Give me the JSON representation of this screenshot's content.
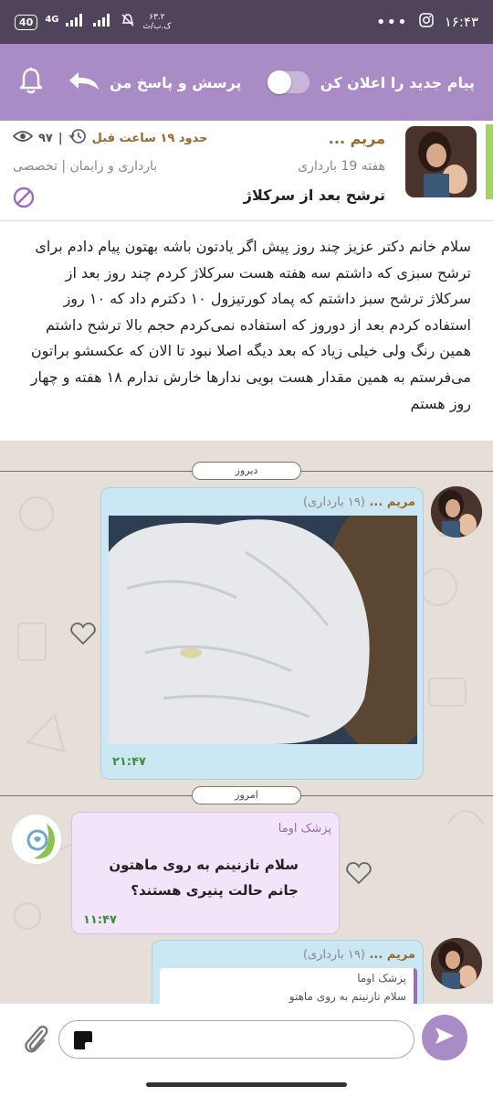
{
  "status_bar": {
    "time": "۱۶:۴۳",
    "battery": "40",
    "network": "4G",
    "data_speed_value": "۶۳.۲",
    "data_speed_unit": "ک.ب/ث",
    "icons": [
      "battery-icon",
      "signal-icon",
      "mute-icon",
      "instagram-icon",
      "more-icon"
    ]
  },
  "top_bar": {
    "notify_label": "پیام جدید را اعلان کن",
    "qa_label": "پرسش و پاسخ من",
    "notify_toggle_on": false,
    "colors": {
      "background": "#a98cc5"
    }
  },
  "post": {
    "author": "مریم ...",
    "week": "هفته 19 بارداری",
    "time_ago": "حدود ۱۹ ساعت قبل",
    "views": "۹۷",
    "category": "بارداری و زایمان | تخصصی",
    "title": "ترشح بعد از سرکلاژ",
    "body": "سلام خانم دکتر عزیز چند روز پیش اگر یادتون باشه بهتون پیام دادم برای ترشح سبزی که داشتم سه هفته هست سرکلاژ کردم چند روز بعد از سرکلاژ ترشح سبز داشتم که پماد کورتیزول ۱۰ دکترم داد که ۱۰ روز استفاده کردم بعد از دوروز که استفاده نمی‌کردم  حجم بالا ترشح داشتم همین رنگ ولی خیلی زیاد که بعد دیگه اصلا نبود تا الان که عکسشو براتون می‌فرستم به همین مقدار هست بویی ندارها خارش ندارم ۱۸ هفته و چهار روز هستم"
  },
  "chat": {
    "date_yesterday": "دیروز",
    "date_today": "امروز",
    "messages": [
      {
        "sender": "مریم ...",
        "sender_sub": "(۱۹ بارداری)",
        "type": "image",
        "time": "۲۱:۴۷"
      },
      {
        "sender": "پزشک اوما",
        "type": "text",
        "text_line1": "سلام نازنینم به روی ماهتون",
        "text_line2": "جانم حالت پنیری هستند؟",
        "time": "۱۱:۴۷"
      },
      {
        "sender": "مریم ...",
        "sender_sub": "(۱۹ بارداری)",
        "type": "reply",
        "quoted_sender": "پزشک اوما",
        "quoted_text": "سلام نازنینم به روی ماهتو"
      }
    ]
  },
  "composer": {
    "input_value": "",
    "icons": [
      "attach-icon",
      "sticker-icon",
      "send-icon"
    ]
  }
}
